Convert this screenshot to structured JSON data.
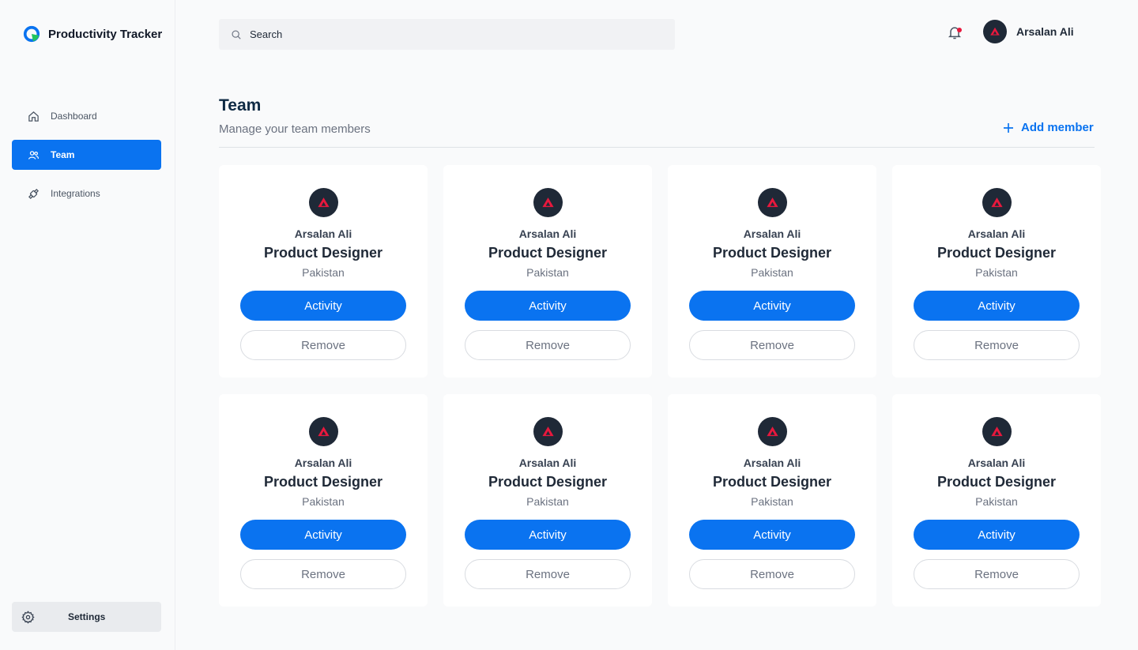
{
  "app": {
    "name": "Productivity Tracker"
  },
  "sidebar": {
    "items": [
      {
        "label": "Dashboard",
        "icon": "home-icon",
        "active": false
      },
      {
        "label": "Team",
        "icon": "team-icon",
        "active": true
      },
      {
        "label": "Integrations",
        "icon": "integrations-icon",
        "active": false
      }
    ],
    "settings": {
      "label": "Settings",
      "icon": "gear-icon"
    }
  },
  "header": {
    "search": {
      "placeholder": "Search"
    },
    "notifications": {
      "icon": "bell-icon",
      "has_unread": true
    },
    "user": {
      "name": "Arsalan Ali"
    }
  },
  "page": {
    "title": "Team",
    "subtitle": "Manage your team members",
    "add_member_label": "Add member"
  },
  "members": [
    {
      "name": "Arsalan Ali",
      "role": "Product Designer",
      "country": "Pakistan",
      "activity_label": "Activity",
      "remove_label": "Remove"
    },
    {
      "name": "Arsalan Ali",
      "role": "Product Designer",
      "country": "Pakistan",
      "activity_label": "Activity",
      "remove_label": "Remove"
    },
    {
      "name": "Arsalan Ali",
      "role": "Product Designer",
      "country": "Pakistan",
      "activity_label": "Activity",
      "remove_label": "Remove"
    },
    {
      "name": "Arsalan Ali",
      "role": "Product Designer",
      "country": "Pakistan",
      "activity_label": "Activity",
      "remove_label": "Remove"
    },
    {
      "name": "Arsalan Ali",
      "role": "Product Designer",
      "country": "Pakistan",
      "activity_label": "Activity",
      "remove_label": "Remove"
    },
    {
      "name": "Arsalan Ali",
      "role": "Product Designer",
      "country": "Pakistan",
      "activity_label": "Activity",
      "remove_label": "Remove"
    },
    {
      "name": "Arsalan Ali",
      "role": "Product Designer",
      "country": "Pakistan",
      "activity_label": "Activity",
      "remove_label": "Remove"
    },
    {
      "name": "Arsalan Ali",
      "role": "Product Designer",
      "country": "Pakistan",
      "activity_label": "Activity",
      "remove_label": "Remove"
    }
  ],
  "colors": {
    "accent": "#0a73f0",
    "notification_dot": "#e8183d",
    "avatar_bg": "#1f2937",
    "avatar_logo": "#e8183d"
  }
}
